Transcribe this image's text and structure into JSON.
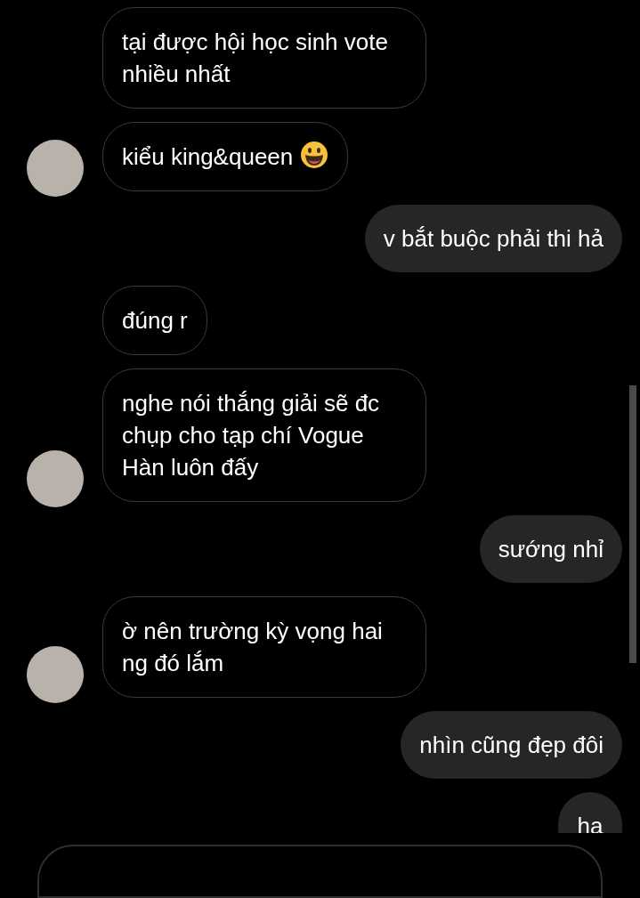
{
  "messages": [
    {
      "kind": "received",
      "text": "tại được hội học sinh vote nhiều nhất",
      "show_avatar": false,
      "emoji": false
    },
    {
      "kind": "received",
      "text": "kiểu king&queen",
      "show_avatar": true,
      "emoji": true
    },
    {
      "kind": "sent",
      "text": "v bắt buộc phải thi hả"
    },
    {
      "kind": "received",
      "text": "đúng r",
      "show_avatar": false,
      "emoji": false
    },
    {
      "kind": "received",
      "text": "nghe nói thắng giải sẽ đc chụp cho tạp chí Vogue Hàn luôn đấy",
      "show_avatar": true,
      "emoji": false
    },
    {
      "kind": "sent",
      "text": "sướng nhỉ"
    },
    {
      "kind": "received",
      "text": "ờ nên trường kỳ vọng hai ng đó lắm",
      "show_avatar": true,
      "emoji": false
    },
    {
      "kind": "sent",
      "text": "nhìn cũng đẹp đôi"
    },
    {
      "kind": "sent",
      "text": "ha"
    }
  ]
}
